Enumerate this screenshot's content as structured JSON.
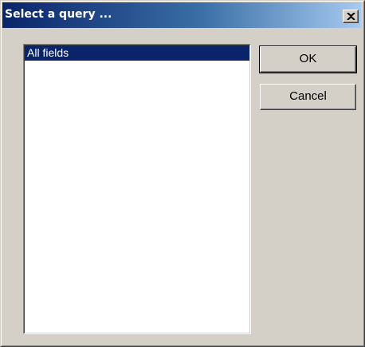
{
  "window": {
    "title": "Select a query ..."
  },
  "query_list": {
    "items": [
      "All fields"
    ],
    "selected_index": 0
  },
  "buttons": {
    "ok_label": "OK",
    "cancel_label": "Cancel"
  },
  "icons": {
    "close": "close-icon"
  },
  "colors": {
    "title_start": "#0a246a",
    "title_end": "#a6caf0",
    "face": "#d4d0c8",
    "selection": "#0a246a"
  }
}
